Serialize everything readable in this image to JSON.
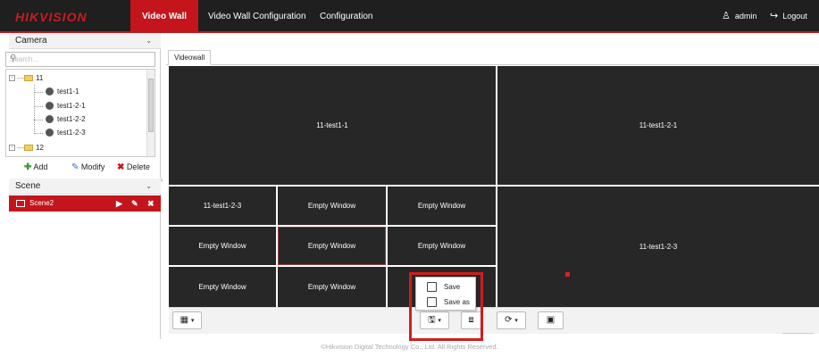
{
  "header": {
    "logo": "HIKVISION",
    "nav": [
      {
        "label": "Video Wall",
        "active": true
      },
      {
        "label": "Video Wall Configuration",
        "active": false
      },
      {
        "label": "Configuration",
        "active": false
      }
    ],
    "user": "admin",
    "logout": "Logout"
  },
  "camera_panel": {
    "title": "Camera",
    "search_placeholder": "Search...",
    "tree": {
      "group1": "11",
      "items": [
        "test1-1",
        "test1-2-1",
        "test1-2-2",
        "test1-2-3"
      ],
      "group2": "12"
    },
    "actions": {
      "add": "Add",
      "modify": "Modify",
      "delete": "Delete"
    }
  },
  "scene_panel": {
    "title": "Scene",
    "scenes": [
      {
        "name": "Scene2",
        "selected": true
      }
    ]
  },
  "wall": {
    "tab": "Videowall",
    "windows": {
      "big_left": "11-test1-1",
      "big_right": "11-test1-2-1",
      "r1c1": "11-test1-2-3",
      "r1c2": "Empty Window",
      "r1c3": "Empty Window",
      "r2c1": "Empty Window",
      "r2c2": "Empty Window",
      "r2c3": "Empty Window",
      "r3c1": "Empty Window",
      "r3c2": "Empty Window",
      "r3c3": "Empty Window",
      "big_bottom_right": "11-test1-2-3"
    }
  },
  "save_menu": {
    "save": "Save",
    "save_as": "Save as"
  },
  "footer": "©Hikvision Digital Technology Co., Ltd. All Rights Reserved.",
  "colors": {
    "brand_red": "#c4151c",
    "header_bg": "#1f1f1f",
    "window_bg": "#272727"
  }
}
